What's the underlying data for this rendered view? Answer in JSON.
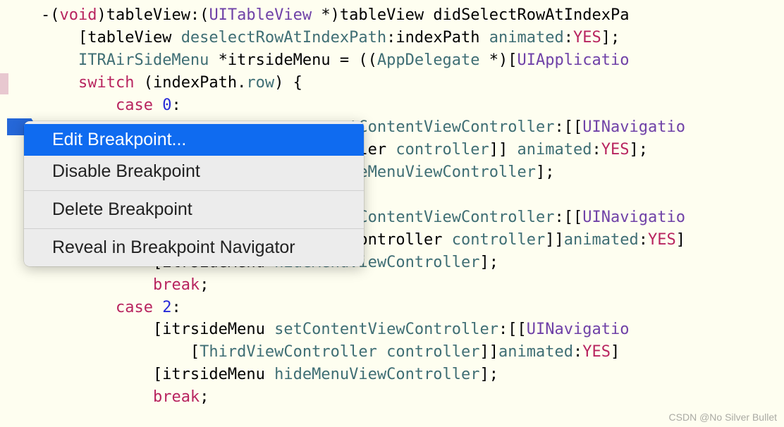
{
  "code": {
    "l1_a": "-(",
    "l1_b": "void",
    "l1_c": ")tableView:(",
    "l1_d": "UITableView",
    "l1_e": " *)tableView didSelectRowAtIndexPa",
    "l2_a": "    [tableView ",
    "l2_b": "deselectRowAtIndexPath",
    "l2_c": ":indexPath ",
    "l2_d": "animated",
    "l2_e": ":",
    "l2_f": "YES",
    "l2_g": "];",
    "l3_a": "    ",
    "l3_b": "ITRAirSideMenu",
    "l3_c": " *itrsideMenu = ((",
    "l3_d": "AppDelegate",
    "l3_e": " *)[",
    "l3_f": "UIApplicatio",
    "l4_a": "    ",
    "l4_b": "switch",
    "l4_c": " (indexPath.",
    "l4_d": "row",
    "l4_e": ") {",
    "l5_a": "        ",
    "l5_b": "case",
    "l5_c": " ",
    "l5_d": "0",
    "l5_e": ":",
    "l6_a": "                                 ",
    "l6_b": "tContentViewController",
    "l6_c": ":[[",
    "l6_d": "UINavigatio",
    "l7_a": "                                 ",
    "l7_b": "ller",
    "l7_c": " ",
    "l7_d": "controller",
    "l7_e": "]] ",
    "l7_f": "animated",
    "l7_g": ":",
    "l7_h": "YES",
    "l7_i": "];",
    "l8_a": "                                 ",
    "l8_b": "deMenuViewController",
    "l8_c": "];",
    "l9_a": "",
    "l10_a": "                                 ",
    "l10_b": "tContentViewController",
    "l10_c": ":[[",
    "l10_d": "UINavigatio",
    "l11_a": "                                 ",
    "l11_b": "Controller",
    "l11_c": " ",
    "l11_d": "controller",
    "l11_e": "]]",
    "l11_f": "animated",
    "l11_g": ":",
    "l11_h": "YES",
    "l11_i": "]",
    "l12_a": "            [itrsideMenu ",
    "l12_b": "hideMenuViewController",
    "l12_c": "];",
    "l13_a": "            ",
    "l13_b": "break",
    "l13_c": ";",
    "l14_a": "        ",
    "l14_b": "case",
    "l14_c": " ",
    "l14_d": "2",
    "l14_e": ":",
    "l15_a": "            [itrsideMenu ",
    "l15_b": "setContentViewController",
    "l15_c": ":[[",
    "l15_d": "UINavigatio",
    "l16_a": "                [",
    "l16_b": "ThirdViewController",
    "l16_c": " ",
    "l16_d": "controller",
    "l16_e": "]]",
    "l16_f": "animated",
    "l16_g": ":",
    "l16_h": "YES",
    "l16_i": "]",
    "l17_a": "            [itrsideMenu ",
    "l17_b": "hideMenuViewController",
    "l17_c": "];",
    "l18_a": "            ",
    "l18_b": "break",
    "l18_c": ";"
  },
  "menu": {
    "edit": "Edit Breakpoint...",
    "disable": "Disable Breakpoint",
    "delete": "Delete Breakpoint",
    "reveal": "Reveal in Breakpoint Navigator"
  },
  "watermark": "CSDN @No Silver Bullet"
}
